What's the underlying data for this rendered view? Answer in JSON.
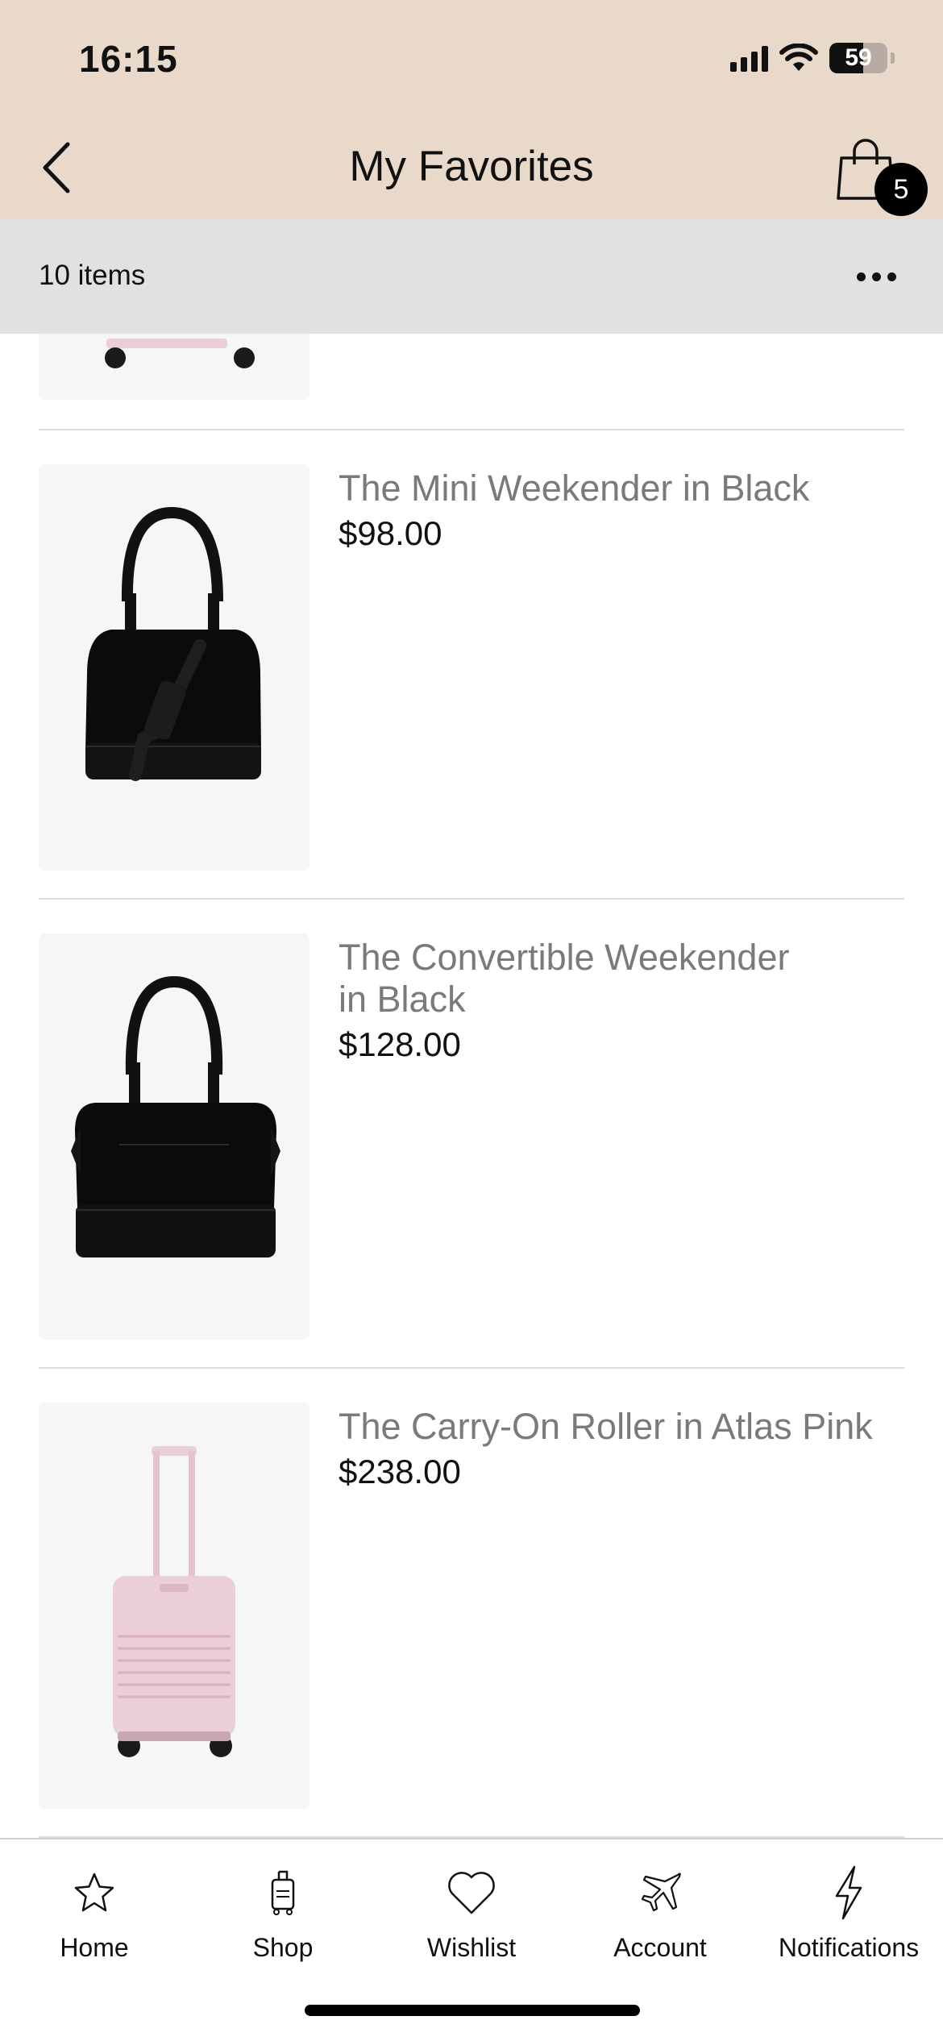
{
  "status_bar": {
    "time": "16:15",
    "battery": "59",
    "battery_level": 0.59
  },
  "nav": {
    "title": "My Favorites",
    "cart_count": "5"
  },
  "subbar": {
    "items_count": "10 items"
  },
  "items": [
    {
      "name": "The Mini Weekender in Black",
      "price": "$98.00",
      "image": "black-mini-weekender-bag"
    },
    {
      "name": "The Convertible Weekender in Black",
      "price": "$128.00",
      "image": "black-convertible-weekender-bag"
    },
    {
      "name": "The Carry-On Roller in Atlas Pink",
      "price": "$238.00",
      "image": "pink-carry-on-roller"
    }
  ],
  "tabs": [
    {
      "label": "Home",
      "icon": "star-icon"
    },
    {
      "label": "Shop",
      "icon": "luggage-icon"
    },
    {
      "label": "Wishlist",
      "icon": "heart-icon"
    },
    {
      "label": "Account",
      "icon": "airplane-icon"
    },
    {
      "label": "Notifications",
      "icon": "lightning-icon"
    }
  ],
  "colors": {
    "header_bg": "#e9d9ca",
    "subbar_bg": "#e1e1e1",
    "thumb_bg": "#f6f6f8",
    "luggage_pink": "#ebcfd6"
  }
}
